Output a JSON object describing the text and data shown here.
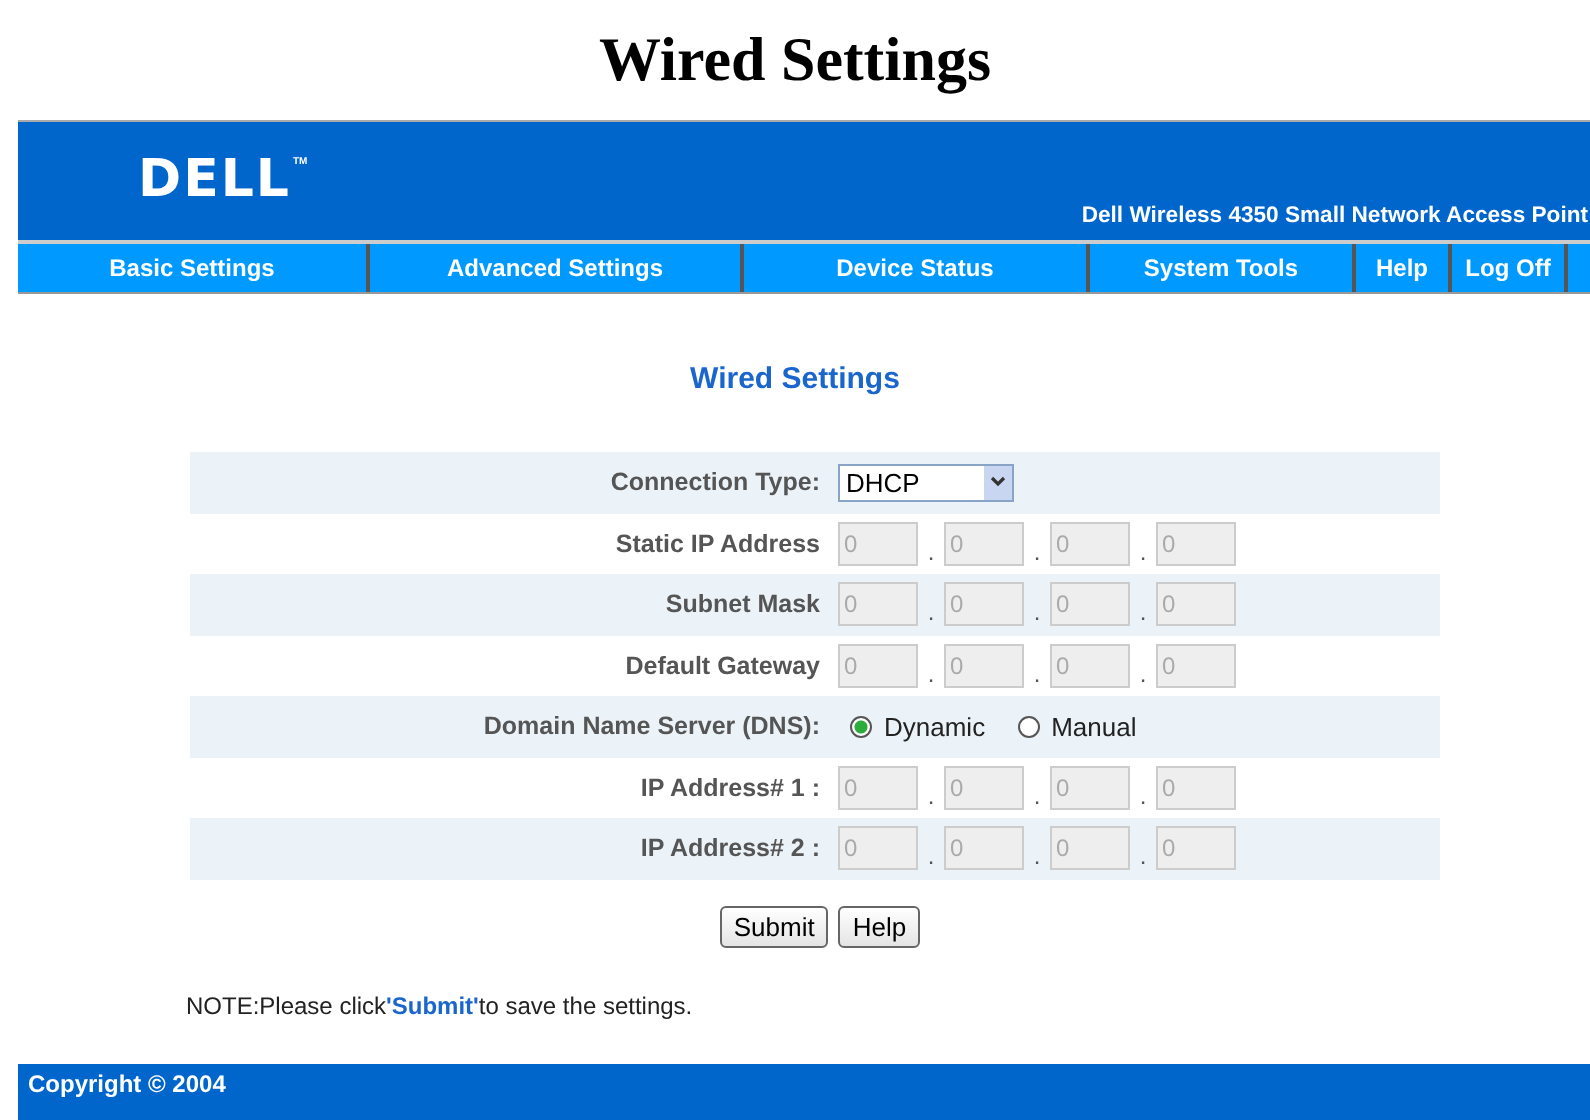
{
  "page_title": "Wired Settings",
  "header": {
    "logo": "DELL",
    "trademark": "TM",
    "product": "Dell Wireless 4350 Small Network Access Point"
  },
  "nav": [
    "Basic Settings",
    "Advanced Settings",
    "Device Status",
    "System Tools",
    "Help",
    "Log Off"
  ],
  "heading": "Wired Settings",
  "octet_separator": ".",
  "rows": [
    {
      "kind": "select",
      "label": "Connection Type:",
      "value": "DHCP"
    },
    {
      "kind": "ip",
      "label": "Static IP Address",
      "octets": [
        "0",
        "0",
        "0",
        "0"
      ],
      "disabled": true
    },
    {
      "kind": "ip",
      "label": "Subnet Mask",
      "octets": [
        "0",
        "0",
        "0",
        "0"
      ],
      "disabled": true
    },
    {
      "kind": "ip",
      "label": "Default Gateway",
      "octets": [
        "0",
        "0",
        "0",
        "0"
      ],
      "disabled": true
    },
    {
      "kind": "radio",
      "label": "Domain Name Server (DNS):",
      "options": [
        {
          "label": "Dynamic",
          "selected": true
        },
        {
          "label": "Manual",
          "selected": false
        }
      ]
    },
    {
      "kind": "ip",
      "label": "IP Address# 1 :",
      "octets": [
        "0",
        "0",
        "0",
        "0"
      ],
      "disabled": true
    },
    {
      "kind": "ip",
      "label": "IP Address# 2 :",
      "octets": [
        "0",
        "0",
        "0",
        "0"
      ],
      "disabled": true
    }
  ],
  "buttons": [
    "Submit",
    "Help"
  ],
  "note": "NOTE:Please click**'Submit'**to save the settings.",
  "footer": "Copyright © 2004"
}
